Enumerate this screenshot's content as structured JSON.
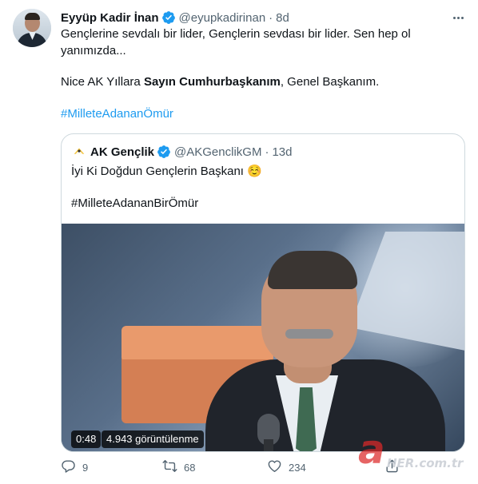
{
  "tweet": {
    "author_name": "Eyyüp Kadir İnan",
    "author_handle": "@eyupkadirinan",
    "separator": "·",
    "time": "8d",
    "line1": "Gençlerine sevdalı bir lider, Gençlerin sevdası bir lider. Sen hep ol",
    "line2": "yanımızda...",
    "line3_pre": "Nice AK Yıllara ",
    "line3_bold": "Sayın Cumhurbaşkanım",
    "line3_post": ", Genel Başkanım.",
    "hashtag": "#MilleteAdananÖmür"
  },
  "quoted": {
    "author_name": "AK Gençlik",
    "author_handle": "@AKGenclikGM",
    "separator": "·",
    "time": "13d",
    "text": "İyi Ki Doğdun Gençlerin Başkanı ☺️",
    "hashtag": "#MilleteAdananBirÖmür",
    "video": {
      "duration": "0:48",
      "views": "4.943 görüntülenme"
    }
  },
  "actions": {
    "reply_count": "9",
    "retweet_count": "68",
    "like_count": "234"
  },
  "watermark": {
    "logo_letter": "a",
    "site_text": "HER.com.tr"
  },
  "colors": {
    "accent": "#1d9bf0",
    "secondary_text": "#536471",
    "border": "#cfd9de"
  },
  "icons": {
    "verified": "verified-badge-icon",
    "more": "more-options-icon",
    "reply": "reply-icon",
    "retweet": "retweet-icon",
    "like": "heart-icon",
    "share": "share-icon"
  }
}
